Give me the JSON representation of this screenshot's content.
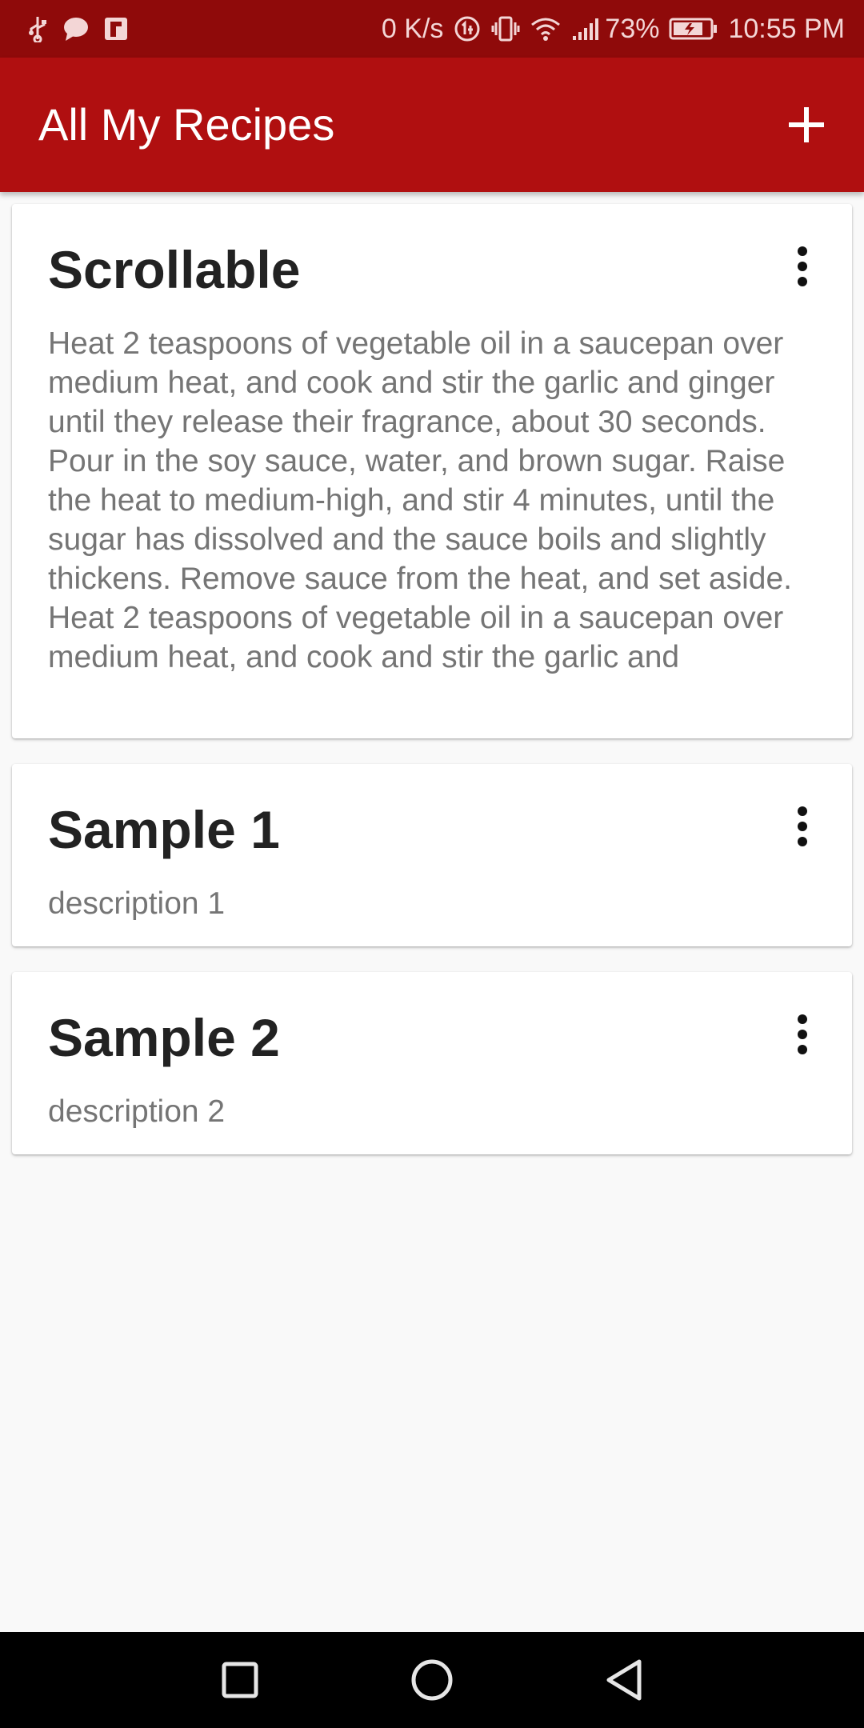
{
  "status_bar": {
    "network_speed": "0 K/s",
    "battery_percent": "73%",
    "time": "10:55 PM",
    "left_icons": [
      "usb-icon",
      "chat-bubble-icon",
      "flipboard-icon"
    ],
    "right_icons": [
      "data-saver-icon",
      "vibrate-icon",
      "wifi-icon",
      "signal-icon",
      "battery-charging-icon"
    ]
  },
  "app_bar": {
    "title": "All My Recipes",
    "add_icon": "plus-icon"
  },
  "recipes": [
    {
      "title": "Scrollable",
      "description": "Heat 2 teaspoons of vegetable oil in a saucepan over medium heat, and cook and stir the garlic and ginger until they release their fragrance, about 30 seconds. Pour in the soy sauce, water, and brown sugar. Raise the heat to medium-high, and stir 4 minutes, until the sugar has dissolved and the sauce boils and slightly thickens. Remove sauce from the heat, and set aside.\nHeat 2 teaspoons of vegetable oil in a saucepan over medium heat, and cook and stir the garlic and"
    },
    {
      "title": "Sample 1",
      "description": "description 1"
    },
    {
      "title": "Sample 2",
      "description": "description 2"
    }
  ],
  "nav_bar": {
    "icons": [
      "recents-square-icon",
      "home-circle-icon",
      "back-triangle-icon"
    ]
  },
  "colors": {
    "status_bar": "#8f0a0a",
    "app_bar": "#b00f10",
    "background": "#f9f9f9",
    "card": "#ffffff",
    "title_text": "#222222",
    "description_text": "#757575"
  }
}
